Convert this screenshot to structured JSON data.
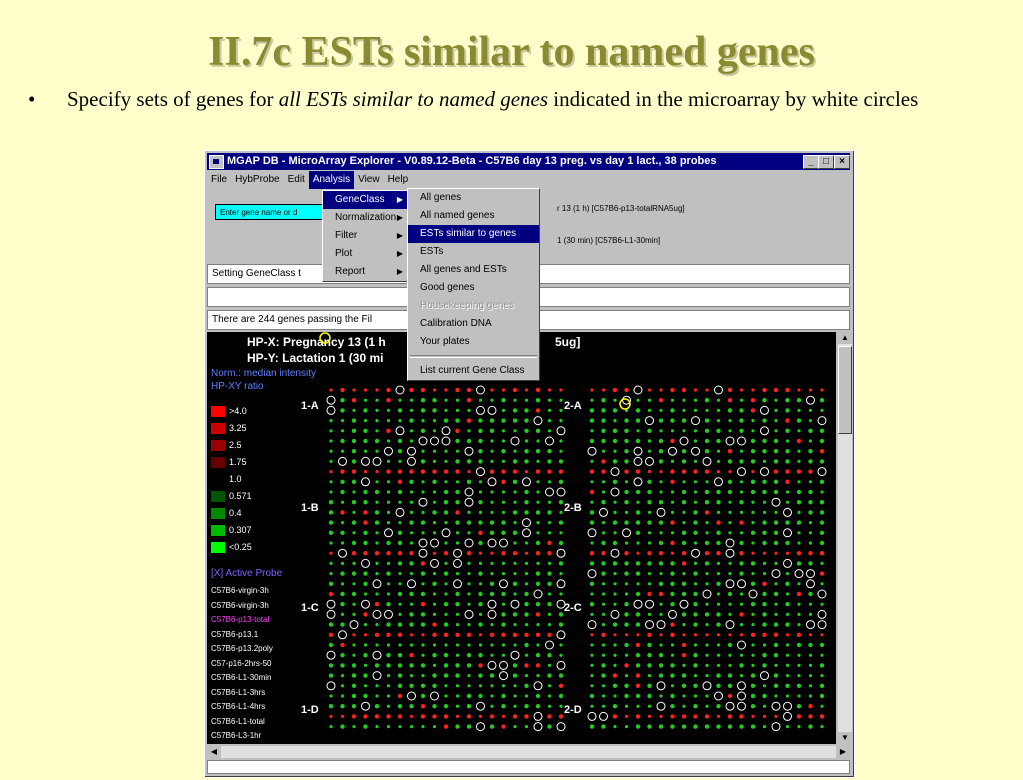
{
  "slide": {
    "title": "II.7c ESTs similar to named genes",
    "bullet": "•",
    "bullet_pre": "Specify sets of  genes for ",
    "bullet_italic": "all ESTs similar to named genes",
    "bullet_post": " indicated in the microarray by white circles"
  },
  "window": {
    "title": "MGAP DB - MicroArray Explorer - V0.89.12-Beta - C57B6 day 13 preg. vs day 1 lact., 38 probes",
    "buttons": [
      "_",
      "□",
      "×"
    ],
    "menu": [
      "File",
      "HybProbe",
      "Edit",
      "Analysis",
      "View",
      "Help"
    ],
    "active_menu": "Analysis"
  },
  "panel": {
    "enter_button": "Enter gene name or d",
    "hp_x_info": "r 13  (1 h) [C57B6-p13-totalRNA5ug]",
    "hp_y_info": "1  (30 min) [C57B6-L1-30min]"
  },
  "status_lines": {
    "line1": "Setting GeneClass t",
    "line2": "",
    "line3": "There are 244 genes passing the Fil"
  },
  "analysis_menu": {
    "items": [
      {
        "label": "GeneClass"
      },
      {
        "label": "Normalization"
      },
      {
        "label": "Filter"
      },
      {
        "label": "Plot"
      },
      {
        "label": "Report"
      }
    ],
    "submenu_glyph": "▶"
  },
  "geneclass_menu": {
    "items": [
      "All genes",
      "All named genes",
      "ESTs similar to genes",
      "ESTs",
      "All genes and ESTs",
      "Good genes",
      "Housekeeping genes",
      "Calibration DNA",
      "Your plates",
      "List current Gene Class"
    ],
    "selected": "ESTs similar to genes",
    "disabled": "Housekeeping genes"
  },
  "canvas": {
    "hp_x": "HP-X: Pregnancy 13  (1 h",
    "hp_x_tail": "5ug]",
    "hp_y": "HP-Y: Lactation 1  (30 mi",
    "norm": "Norm.: median intensity",
    "ratio": "HP-XY ratio",
    "legend": [
      {
        "label": ">4.0",
        "color": "#ff0000"
      },
      {
        "label": "3.25",
        "color": "#cc0000"
      },
      {
        "label": "2.5",
        "color": "#990000"
      },
      {
        "label": "1.75",
        "color": "#660000"
      },
      {
        "label": "1.0",
        "color": "#000000"
      },
      {
        "label": "0.571",
        "color": "#005500"
      },
      {
        "label": "0.4",
        "color": "#008800"
      },
      {
        "label": "0.307",
        "color": "#00bb00"
      },
      {
        "label": "<0.25",
        "color": "#00ff00"
      }
    ],
    "active_probe_label": "[X] Active Probe",
    "probes": [
      {
        "label": "C57B6-virgin-3h"
      },
      {
        "label": "C57B6-virgin-3h"
      },
      {
        "label": "C57B6-p13-total",
        "active": true
      },
      {
        "label": "C57B6-p13.1"
      },
      {
        "label": "C57B6-p13.2poly"
      },
      {
        "label": "C57-p16-2hrs-50"
      },
      {
        "label": "C57B6-L1-30min"
      },
      {
        "label": "C57B6-L1-3hrs"
      },
      {
        "label": "C57B6-L1-4hrs"
      },
      {
        "label": "C57B6-L1-total"
      },
      {
        "label": "C57B6-L3-1hr"
      }
    ],
    "blocks": [
      "1-A",
      "2-A",
      "1-B",
      "2-B",
      "1-C",
      "2-C",
      "1-D",
      "2-D"
    ],
    "colors": {
      "red": "#ff2020",
      "green": "#22cc22",
      "circle": "#ffffff",
      "highlight": "#ffff00"
    }
  },
  "scroll_glyphs": {
    "up": "▲",
    "down": "▼",
    "left": "◀",
    "right": "▶"
  }
}
